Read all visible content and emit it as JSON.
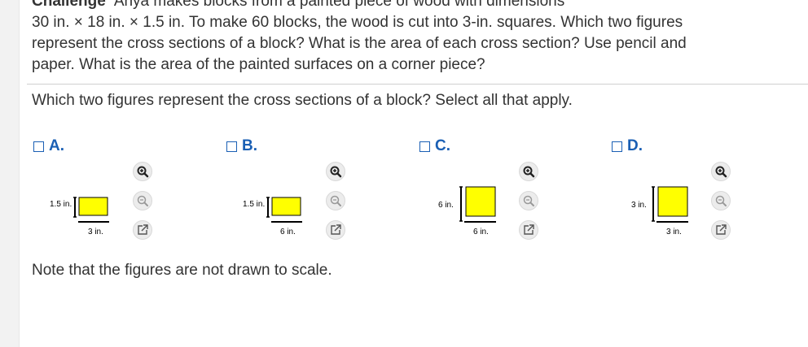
{
  "problem": {
    "challenge_label": "Challenge",
    "line1": "Anya makes blocks from a painted piece of wood with dimensions",
    "line2": "30 in. × 18 in. × 1.5 in. To make 60 blocks, the wood is cut into 3-in. squares. Which two figures",
    "line3": "represent the cross sections of a block? What is the area of each cross section? Use pencil and",
    "line4": "paper. What is the area of the painted surfaces on a corner piece?"
  },
  "question": "Which two figures represent the cross sections of a block? Select all that apply.",
  "options": [
    {
      "letter": "A.",
      "height_label": "1.5 in.",
      "width_label": "3 in."
    },
    {
      "letter": "B.",
      "height_label": "1.5 in.",
      "width_label": "6 in."
    },
    {
      "letter": "C.",
      "height_label": "6 in.",
      "width_label": "6 in."
    },
    {
      "letter": "D.",
      "height_label": "3 in.",
      "width_label": "3 in."
    }
  ],
  "note": "Note that the figures are not drawn to scale.",
  "colors": {
    "figure_fill": "#ffff00",
    "accent": "#1a5fb4"
  },
  "icons": {
    "zoom_in": "zoom-in-icon",
    "zoom_out": "zoom-out-icon",
    "popout": "popout-icon"
  }
}
